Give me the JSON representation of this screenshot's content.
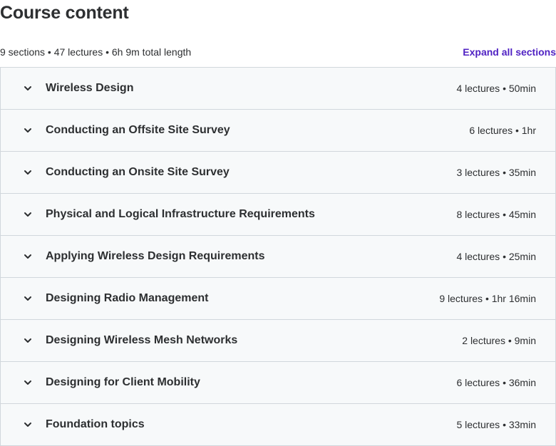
{
  "header": {
    "title": "Course content",
    "summary": "9 sections • 47 lectures • 6h 9m total length",
    "expand_label": "Expand all sections"
  },
  "icons": {
    "section_toggle": "chevron-down-icon"
  },
  "colors": {
    "link": "#5022c3",
    "row_background": "#f7f9fa",
    "border": "#d1d7dc",
    "text": "#2d2f31"
  },
  "sections": [
    {
      "title": "Wireless Design",
      "info": "4 lectures • 50min"
    },
    {
      "title": "Conducting an Offsite Site Survey",
      "info": "6 lectures • 1hr"
    },
    {
      "title": "Conducting an Onsite Site Survey",
      "info": "3 lectures • 35min"
    },
    {
      "title": "Physical and Logical Infrastructure Requirements",
      "info": "8 lectures • 45min"
    },
    {
      "title": "Applying Wireless Design Requirements",
      "info": "4 lectures • 25min"
    },
    {
      "title": "Designing Radio Management",
      "info": "9 lectures • 1hr 16min"
    },
    {
      "title": "Designing Wireless Mesh Networks",
      "info": "2 lectures • 9min"
    },
    {
      "title": "Designing for Client Mobility",
      "info": "6 lectures • 36min"
    },
    {
      "title": "Foundation topics",
      "info": "5 lectures • 33min"
    }
  ]
}
